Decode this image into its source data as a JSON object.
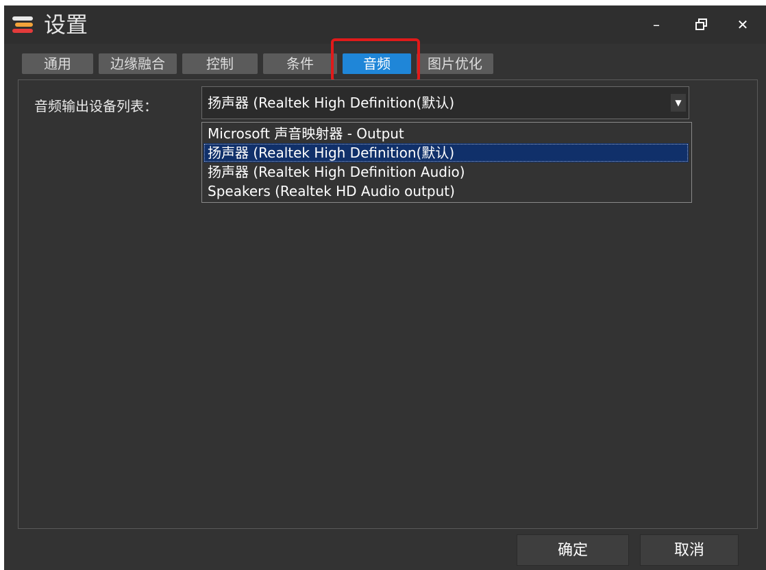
{
  "window": {
    "title": "设置",
    "controls": {
      "minimize": "–",
      "restore": "🗗",
      "close": "✕"
    }
  },
  "tabs": [
    {
      "label": "通用",
      "active": false
    },
    {
      "label": "边缘融合",
      "active": false
    },
    {
      "label": "控制",
      "active": false
    },
    {
      "label": "条件",
      "active": false
    },
    {
      "label": "音频",
      "active": true
    },
    {
      "label": "图片优化",
      "active": false
    }
  ],
  "audio": {
    "device_label": "音频输出设备列表：",
    "selected_device": "扬声器 (Realtek High Definition(默认)",
    "dropdown_arrow": "▼",
    "options": [
      "Microsoft 声音映射器 - Output",
      "扬声器 (Realtek High Definition(默认)",
      "扬声器 (Realtek High Definition Audio)",
      "Speakers (Realtek HD Audio output)"
    ],
    "highlighted_option_index": 1
  },
  "footer": {
    "ok_label": "确定",
    "cancel_label": "取消"
  },
  "colors": {
    "window_bg": "#333333",
    "tab_active": "#1f86d8",
    "tab_inactive": "#5b5b5b",
    "highlight_box": "#e11a1a",
    "selected_option": "#10306a"
  },
  "icons": {
    "app": "app-logo-icon",
    "minimize": "minimize-icon",
    "restore": "restore-icon",
    "close": "close-icon",
    "dropdown": "chevron-down-icon"
  }
}
